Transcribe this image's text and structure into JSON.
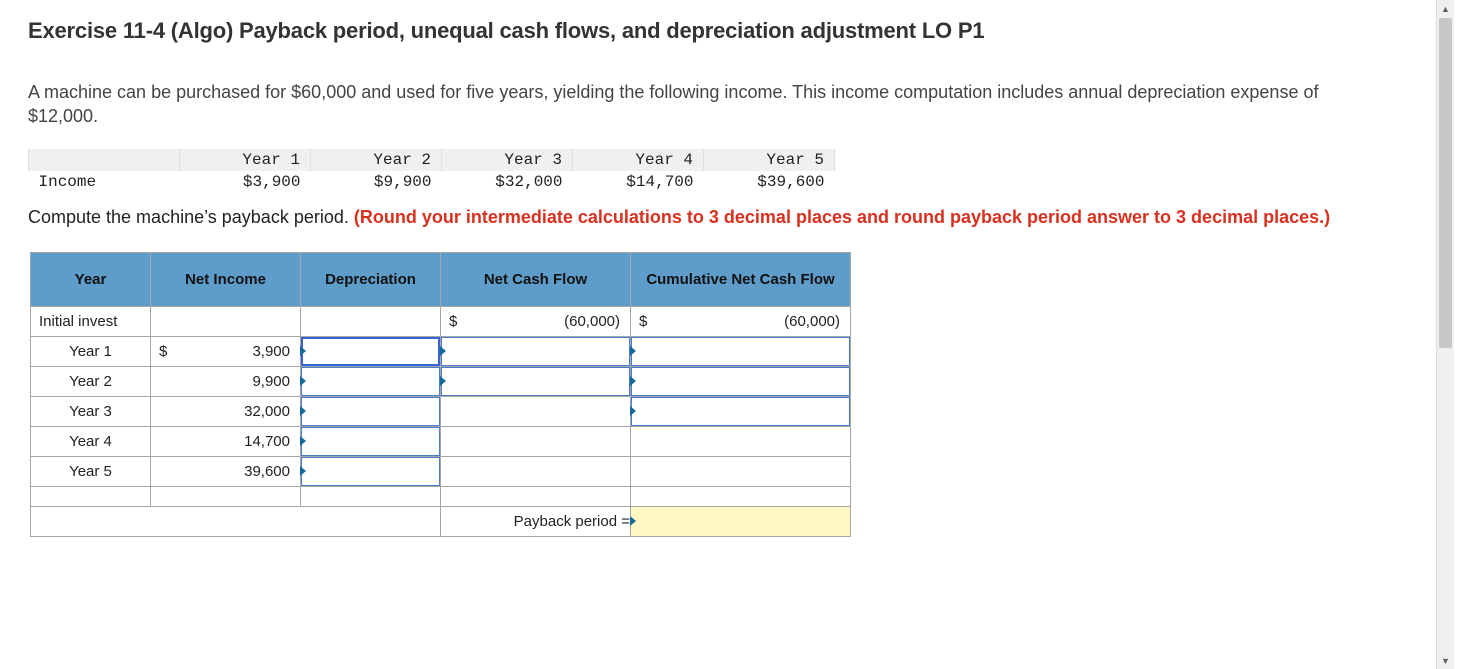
{
  "title": "Exercise 11-4 (Algo) Payback period, unequal cash flows, and depreciation adjustment LO P1",
  "paragraph": "A machine can be purchased for $60,000 and used for five years, yielding the following income. This income computation includes annual depreciation expense of $12,000.",
  "income_table": {
    "row_label": "Income",
    "years": [
      "Year 1",
      "Year 2",
      "Year 3",
      "Year 4",
      "Year 5"
    ],
    "values": [
      "$3,900",
      "$9,900",
      "$32,000",
      "$14,700",
      "$39,600"
    ]
  },
  "instruction_plain": "Compute the machine’s payback period. ",
  "instruction_red": "(Round your intermediate calculations to 3 decimal places and round payback period answer to 3 decimal places.)",
  "worksheet": {
    "headers": {
      "year": "Year",
      "net_income": "Net Income",
      "depreciation": "Depreciation",
      "net_cash_flow": "Net Cash Flow",
      "cumulative": "Cumulative Net Cash Flow"
    },
    "rows": [
      {
        "label": "Initial invest",
        "net_income_sign": "",
        "net_income": "",
        "ncf_sign": "$",
        "ncf": "(60,000)",
        "cum_sign": "$",
        "cum": "(60,000)"
      },
      {
        "label": "Year 1",
        "net_income_sign": "$",
        "net_income": "3,900"
      },
      {
        "label": "Year 2",
        "net_income_sign": "",
        "net_income": "9,900"
      },
      {
        "label": "Year 3",
        "net_income_sign": "",
        "net_income": "32,000"
      },
      {
        "label": "Year 4",
        "net_income_sign": "",
        "net_income": "14,700"
      },
      {
        "label": "Year 5",
        "net_income_sign": "",
        "net_income": "39,600"
      }
    ],
    "payback_label": "Payback period ="
  }
}
